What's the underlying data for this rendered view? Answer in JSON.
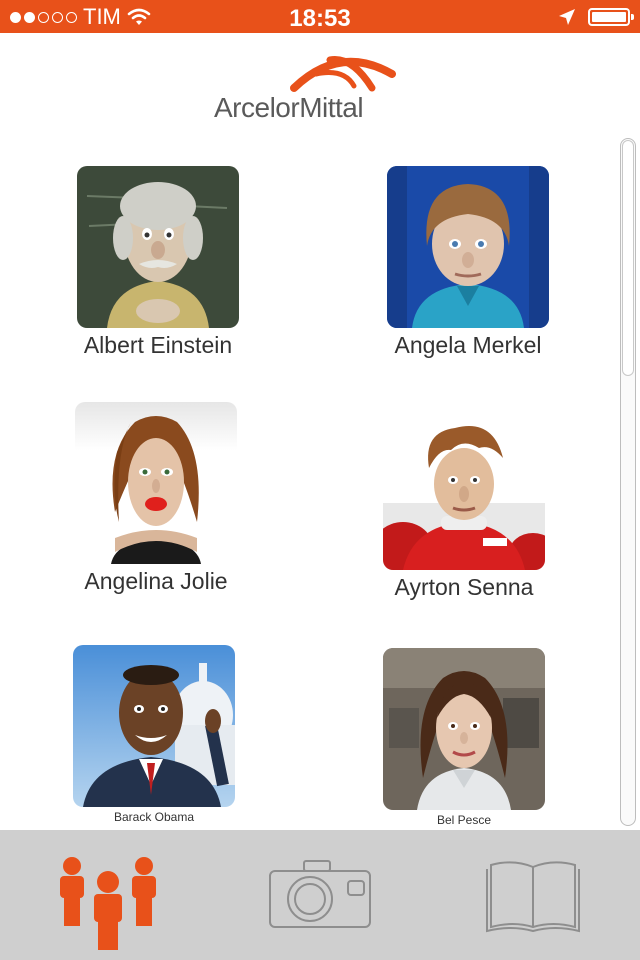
{
  "status_bar": {
    "carrier": "TIM",
    "time": "18:53",
    "signal_dots_filled": 2,
    "signal_dots_total": 5
  },
  "brand": {
    "logo_text": "ArcelorMittal",
    "accent_color": "#e8511a"
  },
  "characters": [
    {
      "name": "Albert Einstein"
    },
    {
      "name": "Angela Merkel"
    },
    {
      "name": "Angelina Jolie"
    },
    {
      "name": "Ayrton Senna"
    },
    {
      "name": "Barack Obama"
    },
    {
      "name": "Bel Pesce"
    }
  ],
  "tab_bar": {
    "tabs": [
      {
        "icon": "people-icon",
        "active": true
      },
      {
        "icon": "camera-icon",
        "active": false
      },
      {
        "icon": "book-icon",
        "active": false
      }
    ]
  }
}
